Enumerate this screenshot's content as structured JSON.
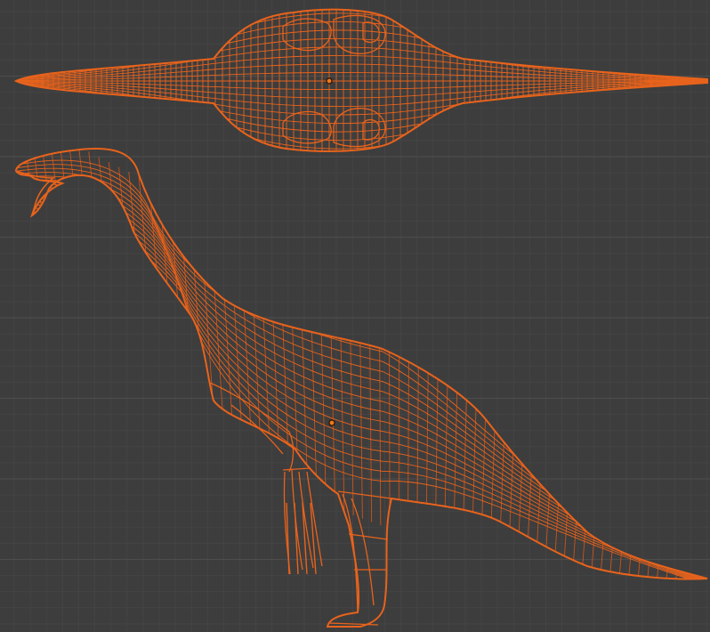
{
  "viewport": {
    "background": "#3d3d3d",
    "grid_minor_color": "#444444",
    "grid_major_color": "#4c4c4c",
    "wire_color": "#e8631c",
    "wire_inner_color": "#c95419",
    "origin_color": "#f07a1a"
  },
  "objects": [
    {
      "view": "top",
      "icon": "mesh-object-icon"
    },
    {
      "view": "side",
      "icon": "mesh-object-icon"
    }
  ]
}
